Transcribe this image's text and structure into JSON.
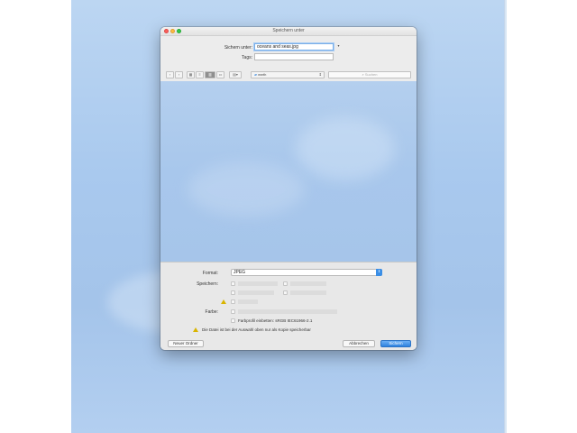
{
  "dialog": {
    "title": "Speichern unter",
    "save_as_label": "Sichern unter:",
    "filename": "oceans and seas.jpg",
    "tags_label": "Tags:",
    "tags_value": ""
  },
  "toolbar": {
    "location": "earth",
    "search_placeholder": "Suchen"
  },
  "options": {
    "format_label": "Format:",
    "format_value": "JPEG",
    "save_label": "Speichern:",
    "color_label": "Farbe:",
    "embed_profile_label": "Farbprofil einbetten:",
    "profile_value": "sRGB IEC61966-2.1",
    "warning_text": "Die Datei ist bei der Auswahl oben nur als Kopie speicherbar"
  },
  "buttons": {
    "new_folder": "Neuer Ordner",
    "cancel": "Abbrechen",
    "save": "Sichern"
  },
  "colors": {
    "accent": "#3a8ee6",
    "desktop": "#a9c9ee"
  }
}
